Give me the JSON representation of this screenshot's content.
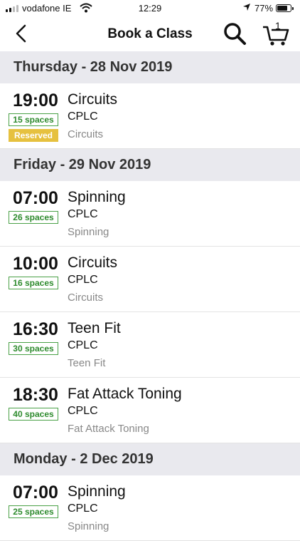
{
  "status": {
    "carrier": "vodafone IE",
    "time": "12:29",
    "battery": "77%"
  },
  "nav": {
    "title": "Book a Class",
    "cart_count": "1"
  },
  "days": [
    {
      "header": "Thursday - 28 Nov 2019",
      "classes": [
        {
          "time": "19:00",
          "spaces": "15 spaces",
          "reserved": "Reserved",
          "name": "Circuits",
          "location": "CPLC",
          "category": "Circuits"
        }
      ]
    },
    {
      "header": "Friday - 29 Nov 2019",
      "classes": [
        {
          "time": "07:00",
          "spaces": "26 spaces",
          "name": "Spinning",
          "location": "CPLC",
          "category": "Spinning"
        },
        {
          "time": "10:00",
          "spaces": "16 spaces",
          "name": "Circuits",
          "location": "CPLC",
          "category": "Circuits"
        },
        {
          "time": "16:30",
          "spaces": "30 spaces",
          "name": "Teen Fit",
          "location": "CPLC",
          "category": "Teen Fit"
        },
        {
          "time": "18:30",
          "spaces": "40 spaces",
          "name": "Fat Attack Toning",
          "location": "CPLC",
          "category": "Fat Attack Toning"
        }
      ]
    },
    {
      "header": "Monday - 2 Dec 2019",
      "classes": [
        {
          "time": "07:00",
          "spaces": "25 spaces",
          "name": "Spinning",
          "location": "CPLC",
          "category": "Spinning"
        }
      ]
    }
  ]
}
